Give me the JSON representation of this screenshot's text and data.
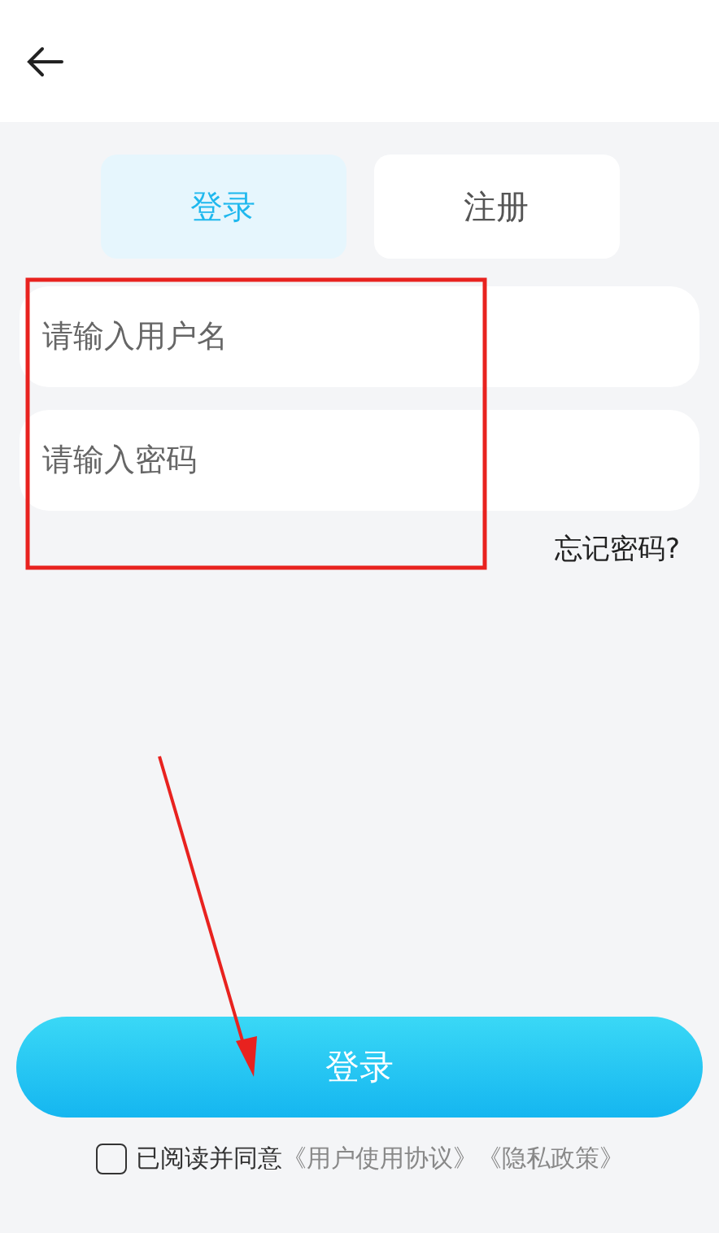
{
  "tabs": [
    {
      "label": "登录",
      "selected": true
    },
    {
      "label": "注册",
      "selected": false
    }
  ],
  "fields": [
    {
      "placeholder": "请输入用户名"
    },
    {
      "placeholder": "请输入密码"
    }
  ],
  "forgot_link": "忘记密码?",
  "submit_button": "登录",
  "agreement": {
    "checked": false,
    "text": "已阅读并同意",
    "links": [
      "《用户使用协议》",
      "《隐私政策》"
    ]
  }
}
